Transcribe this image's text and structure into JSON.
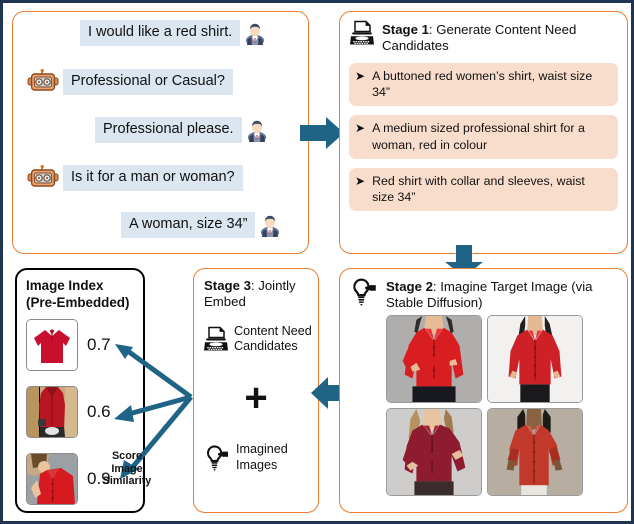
{
  "colors": {
    "outer_border": "#1f3552",
    "panel_border": "#ED7D31",
    "index_border": "#000000",
    "bubble_bg": "#DCE6F1",
    "candidate_bg": "#F8DDCD",
    "arrow": "#1F6487",
    "shirt_red": "#C8102E"
  },
  "chat": {
    "messages": [
      {
        "speaker": "user",
        "text": "I would like a red shirt.",
        "icon": "person-avatar-icon"
      },
      {
        "speaker": "bot",
        "text": "Professional or Casual?",
        "icon": "robot-avatar-icon"
      },
      {
        "speaker": "user",
        "text": "Professional please.",
        "icon": "person-avatar-icon"
      },
      {
        "speaker": "bot",
        "text": "Is it for a man or woman?",
        "icon": "robot-avatar-icon"
      },
      {
        "speaker": "user",
        "text": "A woman, size 34”",
        "icon": "person-avatar-icon"
      }
    ]
  },
  "stage1": {
    "icon": "typewriter-icon",
    "label": "Stage 1",
    "title": ": Generate Content Need Candidates",
    "bullet": "➤",
    "candidates": [
      "A buttoned red women’s shirt, waist size 34”",
      "A medium sized professional shirt for a woman, red in colour",
      "Red shirt with collar and sleeves, waist size 34”"
    ]
  },
  "stage2": {
    "icon": "lightbulb-icon",
    "label": "Stage 2",
    "title": ": Imagine Target Image (via Stable Diffusion)",
    "images": [
      {
        "alt": "red-shirt-woman-arms-crossed",
        "bg": "#b0aeac",
        "shirt": "#D81E20"
      },
      {
        "alt": "red-shirt-woman-standing",
        "bg": "#f2f0ee",
        "shirt": "#CE2127"
      },
      {
        "alt": "dark-red-shirt-woman-arms-crossed",
        "bg": "#cfcdcb",
        "shirt": "#8E1B2E"
      },
      {
        "alt": "red-shirt-woman-rolled-sleeves",
        "bg": "#b7ada0",
        "shirt": "#C0392B"
      }
    ]
  },
  "stage3": {
    "label": "Stage 3",
    "title": ": Jointly Embed",
    "items": [
      {
        "icon": "typewriter-icon",
        "label": "Content Need Candidates"
      },
      {
        "icon": "lightbulb-icon",
        "label": "Imagined Images"
      }
    ],
    "plus": "+"
  },
  "index": {
    "title_line1": "Image Index",
    "title_line2": "(Pre-Embedded)",
    "rows": [
      {
        "alt": "red-polo-shirt-thumbnail",
        "score": "0.7",
        "bg": "#ffffff",
        "shirt": "#C8102E"
      },
      {
        "alt": "red-dress-shirt-man-thumbnail",
        "score": "0.6",
        "bg": "#c9a77c",
        "shirt": "#B81622"
      },
      {
        "alt": "red-blouse-woman-thumbnail",
        "score": "0.9",
        "bg": "#9aa0a4",
        "shirt": "#D71920"
      }
    ],
    "score_label": "Score Image Similarity"
  },
  "arrows": {
    "chat_to_stage1": "arrow-right",
    "stage1_to_stage2": "arrow-down",
    "stage2_to_stage3": "arrow-left",
    "stage3_to_index": "arrow-left"
  }
}
